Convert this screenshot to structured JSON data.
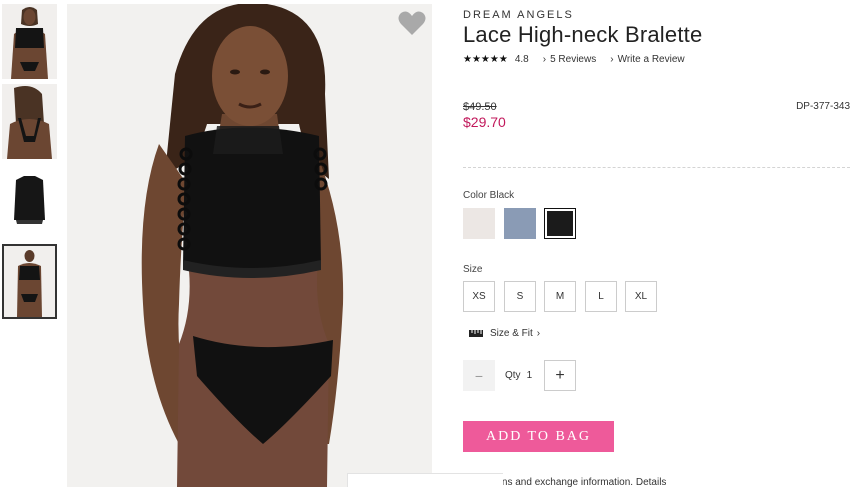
{
  "thumbnails": [
    {
      "name": "thumb-front-view"
    },
    {
      "name": "thumb-back-view"
    },
    {
      "name": "thumb-flat-lay"
    },
    {
      "name": "thumb-full-look",
      "active": true
    }
  ],
  "favorite": {
    "icon": "heart-icon"
  },
  "product": {
    "brand": "DREAM ANGELS",
    "title": "Lace High-neck Bralette",
    "stars": "★★★★★",
    "rating": "4.8",
    "reviews_link": "5 Reviews",
    "write_review_link": "Write a Review",
    "old_price": "$49.50",
    "price": "$29.70",
    "sku": "DP-377-343"
  },
  "color": {
    "label": "Color Black",
    "swatches": [
      {
        "name": "ivory",
        "hex": "#ece7e4"
      },
      {
        "name": "blue",
        "hex": "#8a9bb5"
      },
      {
        "name": "black",
        "hex": "#1b1b1b",
        "selected": true
      }
    ]
  },
  "size": {
    "label": "Size",
    "options": [
      "XS",
      "S",
      "M",
      "L",
      "XL"
    ],
    "fit_link": "Size & Fit"
  },
  "quantity": {
    "label": "Qty",
    "value": "1",
    "minus": "−",
    "plus": "+"
  },
  "cta": {
    "add_to_bag": "ADD TO BAG"
  },
  "footer": {
    "returns_text": "urns and exchange information. Details"
  },
  "colors": {
    "accent": "#ee5a9a",
    "sale": "#c2185b"
  }
}
